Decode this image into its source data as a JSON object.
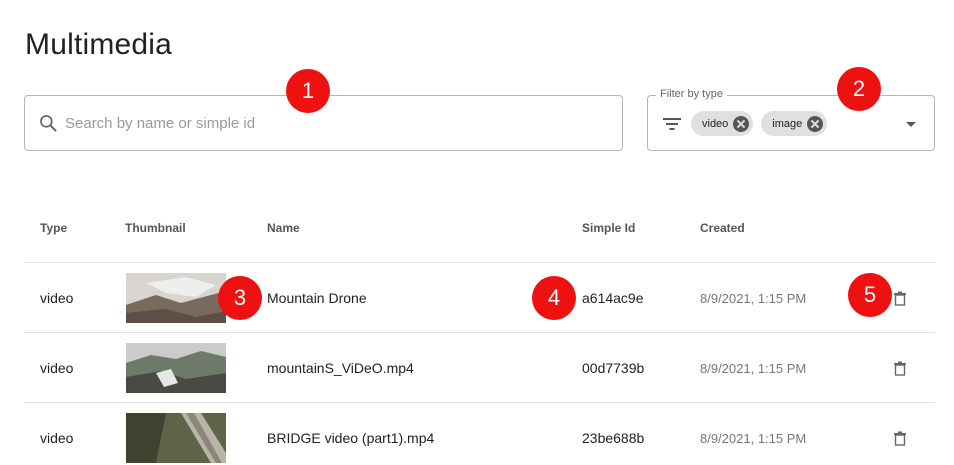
{
  "page": {
    "title": "Multimedia"
  },
  "search": {
    "placeholder": "Search by name or simple id",
    "value": ""
  },
  "filter": {
    "legend": "Filter by type",
    "chips": [
      {
        "label": "video"
      },
      {
        "label": "image"
      }
    ]
  },
  "table": {
    "headers": {
      "type": "Type",
      "thumbnail": "Thumbnail",
      "name": "Name",
      "simple_id": "Simple Id",
      "created": "Created"
    },
    "rows": [
      {
        "type": "video",
        "name": "Mountain Drone",
        "simple_id": "a614ac9e",
        "created": "8/9/2021, 1:15 PM"
      },
      {
        "type": "video",
        "name": "mountainS_ViDeO.mp4",
        "simple_id": "00d7739b",
        "created": "8/9/2021, 1:15 PM"
      },
      {
        "type": "video",
        "name": "BRIDGE video (part1).mp4",
        "simple_id": "23be688b",
        "created": "8/9/2021, 1:15 PM"
      }
    ]
  },
  "badges": [
    "1",
    "2",
    "3",
    "4",
    "5"
  ],
  "colors": {
    "badge": "#ee1111",
    "chip": "#e0e0e0",
    "border": "#b5b5b5"
  }
}
